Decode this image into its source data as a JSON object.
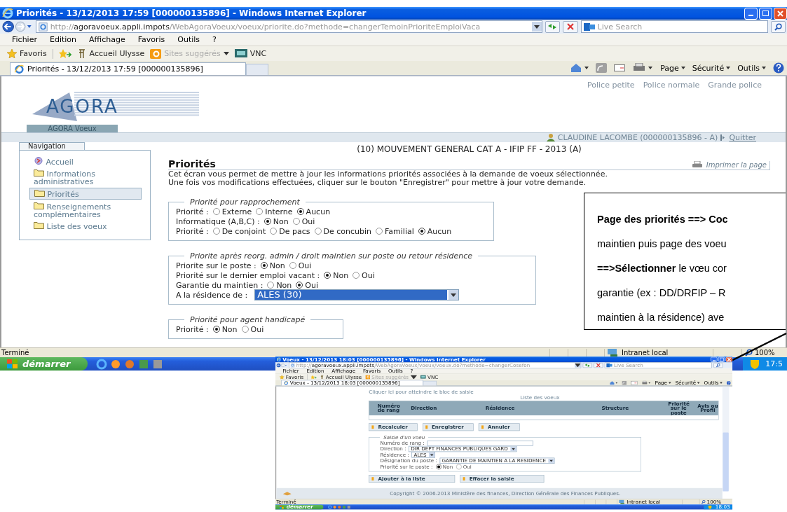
{
  "main_window": {
    "title": "Priorités - 13/12/2013 17:59 [000000135896] - Windows Internet Explorer",
    "address": {
      "scheme": "http://",
      "host": "agoravoeux.appli.impots",
      "path": "/WebAgoraVoeux/voeux/priorite.do?methode=changerTemoinPrioriteEmploiVaca"
    },
    "search_placeholder": "Live Search",
    "menu": [
      "Fichier",
      "Edition",
      "Affichage",
      "Favoris",
      "Outils",
      "?"
    ],
    "favorites_label": "Favoris",
    "favorites": [
      {
        "label": "Accueil Ulysse",
        "disabled": false
      },
      {
        "label": "Sites suggérés",
        "disabled": true
      },
      {
        "label": "VNC",
        "disabled": false
      }
    ],
    "tab": "Priorités - 13/12/2013 17:59 [000000135896]",
    "commands": [
      "Page",
      "Sécurité",
      "Outils"
    ],
    "status": "Terminé",
    "zone": "Intranet local",
    "zoom": "100%",
    "start": "démarrer",
    "clock": "17:5"
  },
  "page": {
    "font_links": [
      "Police petite",
      "Police normale",
      "Grande police"
    ],
    "logo": "AGORA",
    "app_tab": "AGORA Voeux",
    "user": "CLAUDINE LACOMBE (000000135896 - A)",
    "logout": "Quitter",
    "nav_title": "Navigation",
    "nav": [
      {
        "label": "Accueil",
        "kind": "home",
        "selected": false
      },
      {
        "label": "Informations administratives",
        "kind": "folder",
        "selected": false
      },
      {
        "label": "Priorités",
        "kind": "folder",
        "selected": true
      },
      {
        "label": "Renseignements complémentaires",
        "kind": "folder",
        "selected": false
      },
      {
        "label": "Liste des voeux",
        "kind": "folder",
        "selected": false
      }
    ],
    "context": "(10) MOUVEMENT GENERAL CAT A - IFIP FF - 2013 (A)",
    "title": "Priorités",
    "print": "Imprimer la page",
    "intro": [
      "Cet écran vous permet de mettre à jour les informations priorités associées à la demande de voeux sélectionnée.",
      "Une fois vos modifications effectuées, cliquer sur le bouton \"Enregistrer\" pour mettre à jour votre demande."
    ],
    "sections": [
      {
        "legend": "Priorité pour rapprochement",
        "rows": [
          {
            "kind": "radio",
            "label": "Priorité :",
            "options": [
              {
                "label": "Externe",
                "selected": false
              },
              {
                "label": "Interne",
                "selected": false
              },
              {
                "label": "Aucun",
                "selected": true
              }
            ]
          },
          {
            "kind": "radio",
            "label": "Informatique (A,B,C) :",
            "options": [
              {
                "label": "Non",
                "selected": true
              },
              {
                "label": "Oui",
                "selected": false
              }
            ]
          },
          {
            "kind": "radio",
            "label": "Priorité :",
            "options": [
              {
                "label": "De conjoint",
                "selected": false
              },
              {
                "label": "De pacs",
                "selected": false
              },
              {
                "label": "De concubin",
                "selected": false
              },
              {
                "label": "Familial",
                "selected": false
              },
              {
                "label": "Aucun",
                "selected": true
              }
            ]
          }
        ]
      },
      {
        "legend": "Priorite après reorg. admin / droit maintien sur poste ou retour résidence",
        "rows": [
          {
            "kind": "radio",
            "label": "Priorite sur le poste :",
            "options": [
              {
                "label": "Non",
                "selected": true
              },
              {
                "label": "Oui",
                "selected": false
              }
            ]
          },
          {
            "kind": "radio",
            "label": "Priorité sur le dernier emploi vacant :",
            "options": [
              {
                "label": "Non",
                "selected": true
              },
              {
                "label": "Oui",
                "selected": false
              }
            ]
          },
          {
            "kind": "radio",
            "label": "Garantie du maintien :",
            "options": [
              {
                "label": "Non",
                "selected": false
              },
              {
                "label": "Oui",
                "selected": true
              }
            ]
          },
          {
            "kind": "select",
            "label": "A la résidence de :",
            "value": "ALES (30)"
          }
        ]
      },
      {
        "legend": "Priorité pour agent handicapé",
        "rows": [
          {
            "kind": "radio",
            "label": "Priorité :",
            "options": [
              {
                "label": "Non",
                "selected": true
              },
              {
                "label": "Oui",
                "selected": false
              }
            ]
          }
        ]
      }
    ]
  },
  "callout": {
    "lines": [
      "**Page des priorités ==> Coc**",
      "maintien puis page des voeu",
      "**==>Sélectionner** le vœu cor",
      "garantie (ex : DD/DRFIP – R",
      "maintien à la résidence)  ave"
    ]
  },
  "inset_window": {
    "title": "Voeux - 13/12/2013 18:03 [000000135896] - Windows Internet Explorer",
    "address": {
      "scheme": "http://",
      "host": "agoravoeux.appli.impots",
      "path": "/WebAgoraVoeux/voeux/voeux.do?methode=changerCosefon"
    },
    "search_placeholder": "Live Search",
    "menu": [
      "Fichier",
      "Edition",
      "Affichage",
      "Favoris",
      "Outils",
      "?"
    ],
    "favorites_label": "Favoris",
    "favorites": [
      {
        "label": "Accueil Ulysse",
        "disabled": false
      },
      {
        "label": "Sites suggérés",
        "disabled": true
      },
      {
        "label": "VNC",
        "disabled": false
      }
    ],
    "tab": "Voeux - 13/12/2013 18:03 [000000135896]",
    "commands": [
      "Page",
      "Sécurité",
      "Outils"
    ],
    "status": "Terminé",
    "zone": "Intranet local",
    "zoom": "100%",
    "start": "démarrer",
    "clock": "18:03",
    "page": {
      "skip_link": "Cliquer ici pour atteindre le bloc de saisie",
      "list_title": "Liste des voeux",
      "columns": [
        "Numéro de rang",
        "Direction",
        "Résidence",
        "Structure",
        "Priorité sur le poste",
        "Avis ou Profil"
      ],
      "buttons": [
        "Recalculer",
        "Enregistrer",
        "Annuler"
      ],
      "form": {
        "legend": "Saisie d'un voeu",
        "fields": [
          {
            "kind": "text",
            "label": "Numéro de rang :"
          },
          {
            "kind": "select",
            "label": "Direction :",
            "value": "DIR DEPT FINANCES PUBLIQUES GARD"
          },
          {
            "kind": "select",
            "label": "Résidence :",
            "value": "ALES"
          },
          {
            "kind": "select",
            "label": "Désignation du poste :",
            "value": "GARANTIE DE MAINTIEN A LA RESIDENCE"
          },
          {
            "kind": "radio",
            "label": "Priorité sur le poste :",
            "options": [
              {
                "label": "Non",
                "selected": true
              },
              {
                "label": "Oui",
                "selected": false
              }
            ]
          }
        ]
      },
      "actions": [
        "Ajouter à la liste",
        "Effacer la saisie"
      ],
      "copyright": "Copyright © 2006-2013 Ministère des finances, Direction Générale des Finances Publiques."
    }
  }
}
